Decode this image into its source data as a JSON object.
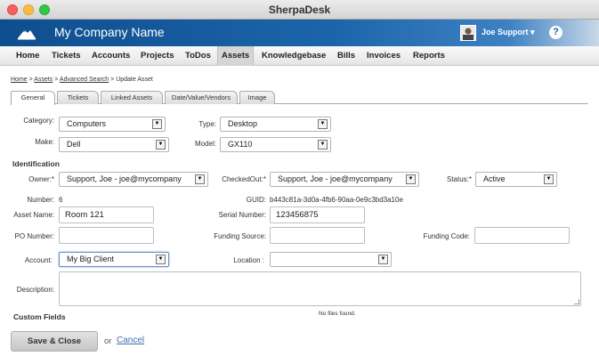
{
  "window": {
    "title": "SherpaDesk"
  },
  "header": {
    "company": "My Company Name",
    "user": "Joe Support ▾",
    "help": "?"
  },
  "nav": [
    "Home",
    "Tickets",
    "Accounts",
    "Projects",
    "ToDos",
    "Assets",
    "Knowledgebase",
    "Bills",
    "Invoices",
    "Reports"
  ],
  "nav_active": "Assets",
  "breadcrumb": {
    "home": "Home",
    "sep": ">",
    "assets": "Assets",
    "advanced": "Advanced Search",
    "current": "Update Asset"
  },
  "tabs": [
    "General",
    "Tickets",
    "Linked Assets",
    "Date/Value/Vendors",
    "Image"
  ],
  "tab_active": "General",
  "form": {
    "category_label": "Category:",
    "category_value": "Computers",
    "type_label": "Type:",
    "type_value": "Desktop",
    "make_label": "Make:",
    "make_value": "Dell",
    "model_label": "Model:",
    "model_value": "GX110",
    "identification_header": "Identification",
    "owner_label": "Owner:*",
    "owner_value": "Support, Joe - joe@mycompany",
    "checkedout_label": "CheckedOut:*",
    "checkedout_value": "Support, Joe - joe@mycompany",
    "status_label": "Status:*",
    "status_value": "Active",
    "number_label": "Number:",
    "number_value": "6",
    "guid_label": "GUID:",
    "guid_value": "b443c81a-3d0a-4fb6-90aa-0e9c3bd3a10e",
    "asset_name_label": "Asset Name:",
    "asset_name_value": "Room 121",
    "serial_label": "Serial Number:",
    "serial_value": "123456875",
    "po_label": "PO Number:",
    "po_value": "",
    "funding_source_label": "Funding Source:",
    "funding_source_value": "",
    "funding_code_label": "Funding Code:",
    "funding_code_value": "",
    "account_label": "Account:",
    "account_value": "My Big Client",
    "location_label": "Location :",
    "location_value": "",
    "description_label": "Description:",
    "custom_fields_header": "Custom Fields",
    "no_files": "No files found."
  },
  "actions": {
    "save": "Save & Close",
    "or": "or",
    "cancel": "Cancel"
  },
  "colors": {
    "header_blue": "#1c64aa",
    "link_blue": "#3a6fae"
  }
}
